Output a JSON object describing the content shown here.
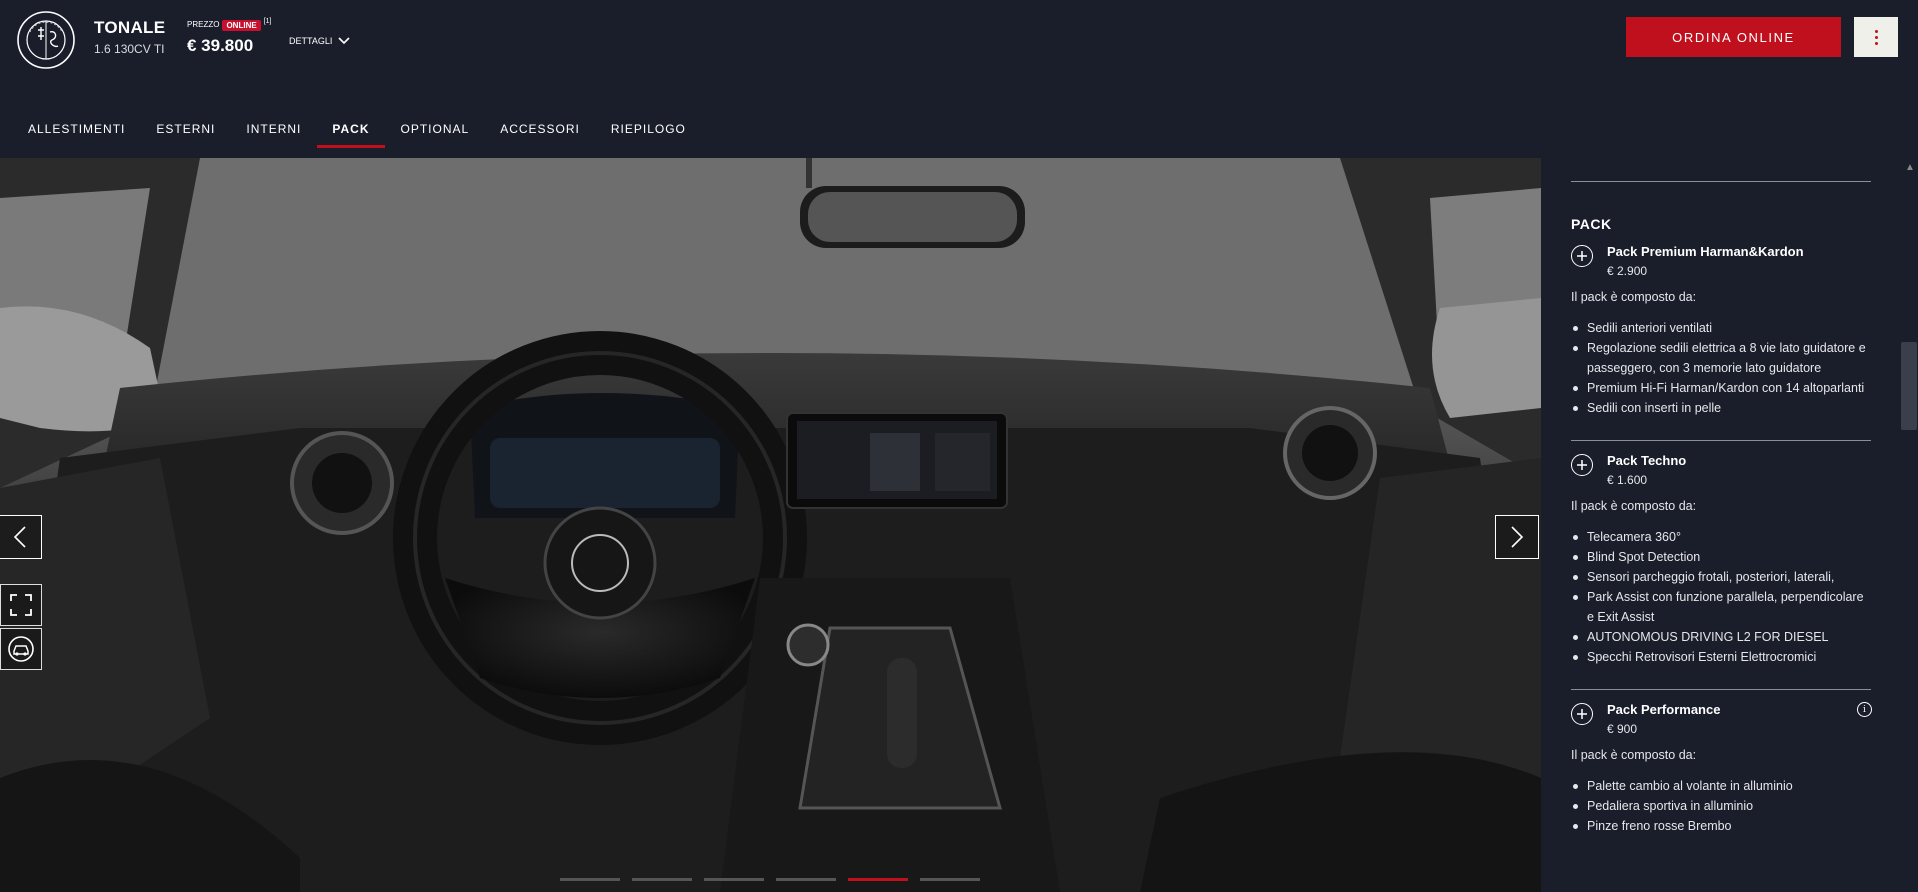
{
  "header": {
    "model_name": "TONALE",
    "model_version": "1.6 130CV TI",
    "price_label": "PREZZO",
    "price_badge": "ONLINE",
    "price_footnote": "[1]",
    "price_value": "€ 39.800",
    "details_label": "DETTAGLI",
    "order_button": "ORDINA ONLINE"
  },
  "tabs": [
    {
      "label": "ALLESTIMENTI",
      "active": false
    },
    {
      "label": "ESTERNI",
      "active": false
    },
    {
      "label": "INTERNI",
      "active": false
    },
    {
      "label": "PACK",
      "active": true
    },
    {
      "label": "OPTIONAL",
      "active": false
    },
    {
      "label": "ACCESSORI",
      "active": false
    },
    {
      "label": "RIEPILOGO",
      "active": false
    }
  ],
  "viewer": {
    "image_count": 6,
    "active_index": 4
  },
  "panel": {
    "section_title": "PACK",
    "packs": [
      {
        "name": "Pack Premium Harman&Kardon",
        "price": "€ 2.900",
        "description": "Il pack è composto da:",
        "items": [
          "Sedili anteriori ventilati",
          "Regolazione sedili elettrica a 8 vie lato guidatore e passeggero, con 3 memorie lato guidatore",
          "Premium Hi-Fi Harman/Kardon con 14 altoparlanti",
          "Sedili con inserti in pelle"
        ]
      },
      {
        "name": "Pack Techno",
        "price": "€ 1.600",
        "description": "Il pack è composto da:",
        "items": [
          "Telecamera 360°",
          "Blind Spot Detection",
          "Sensori parcheggio frotali, posteriori, laterali,",
          "Park Assist con funzione parallela, perpendicolare e Exit Assist",
          "AUTONOMOUS DRIVING L2 FOR DIESEL",
          "Specchi Retrovisori Esterni Elettrocromici"
        ]
      },
      {
        "name": "Pack Performance",
        "price": "€ 900",
        "description": "Il pack è composto da:",
        "items": [
          "Palette cambio al volante in alluminio",
          "Pedaliera sportiva in alluminio",
          "Pinze freno rosse Brembo"
        ]
      }
    ]
  },
  "colors": {
    "background": "#1a1e2b",
    "accent": "#c0101d",
    "menu_button": "#eef0e9"
  }
}
